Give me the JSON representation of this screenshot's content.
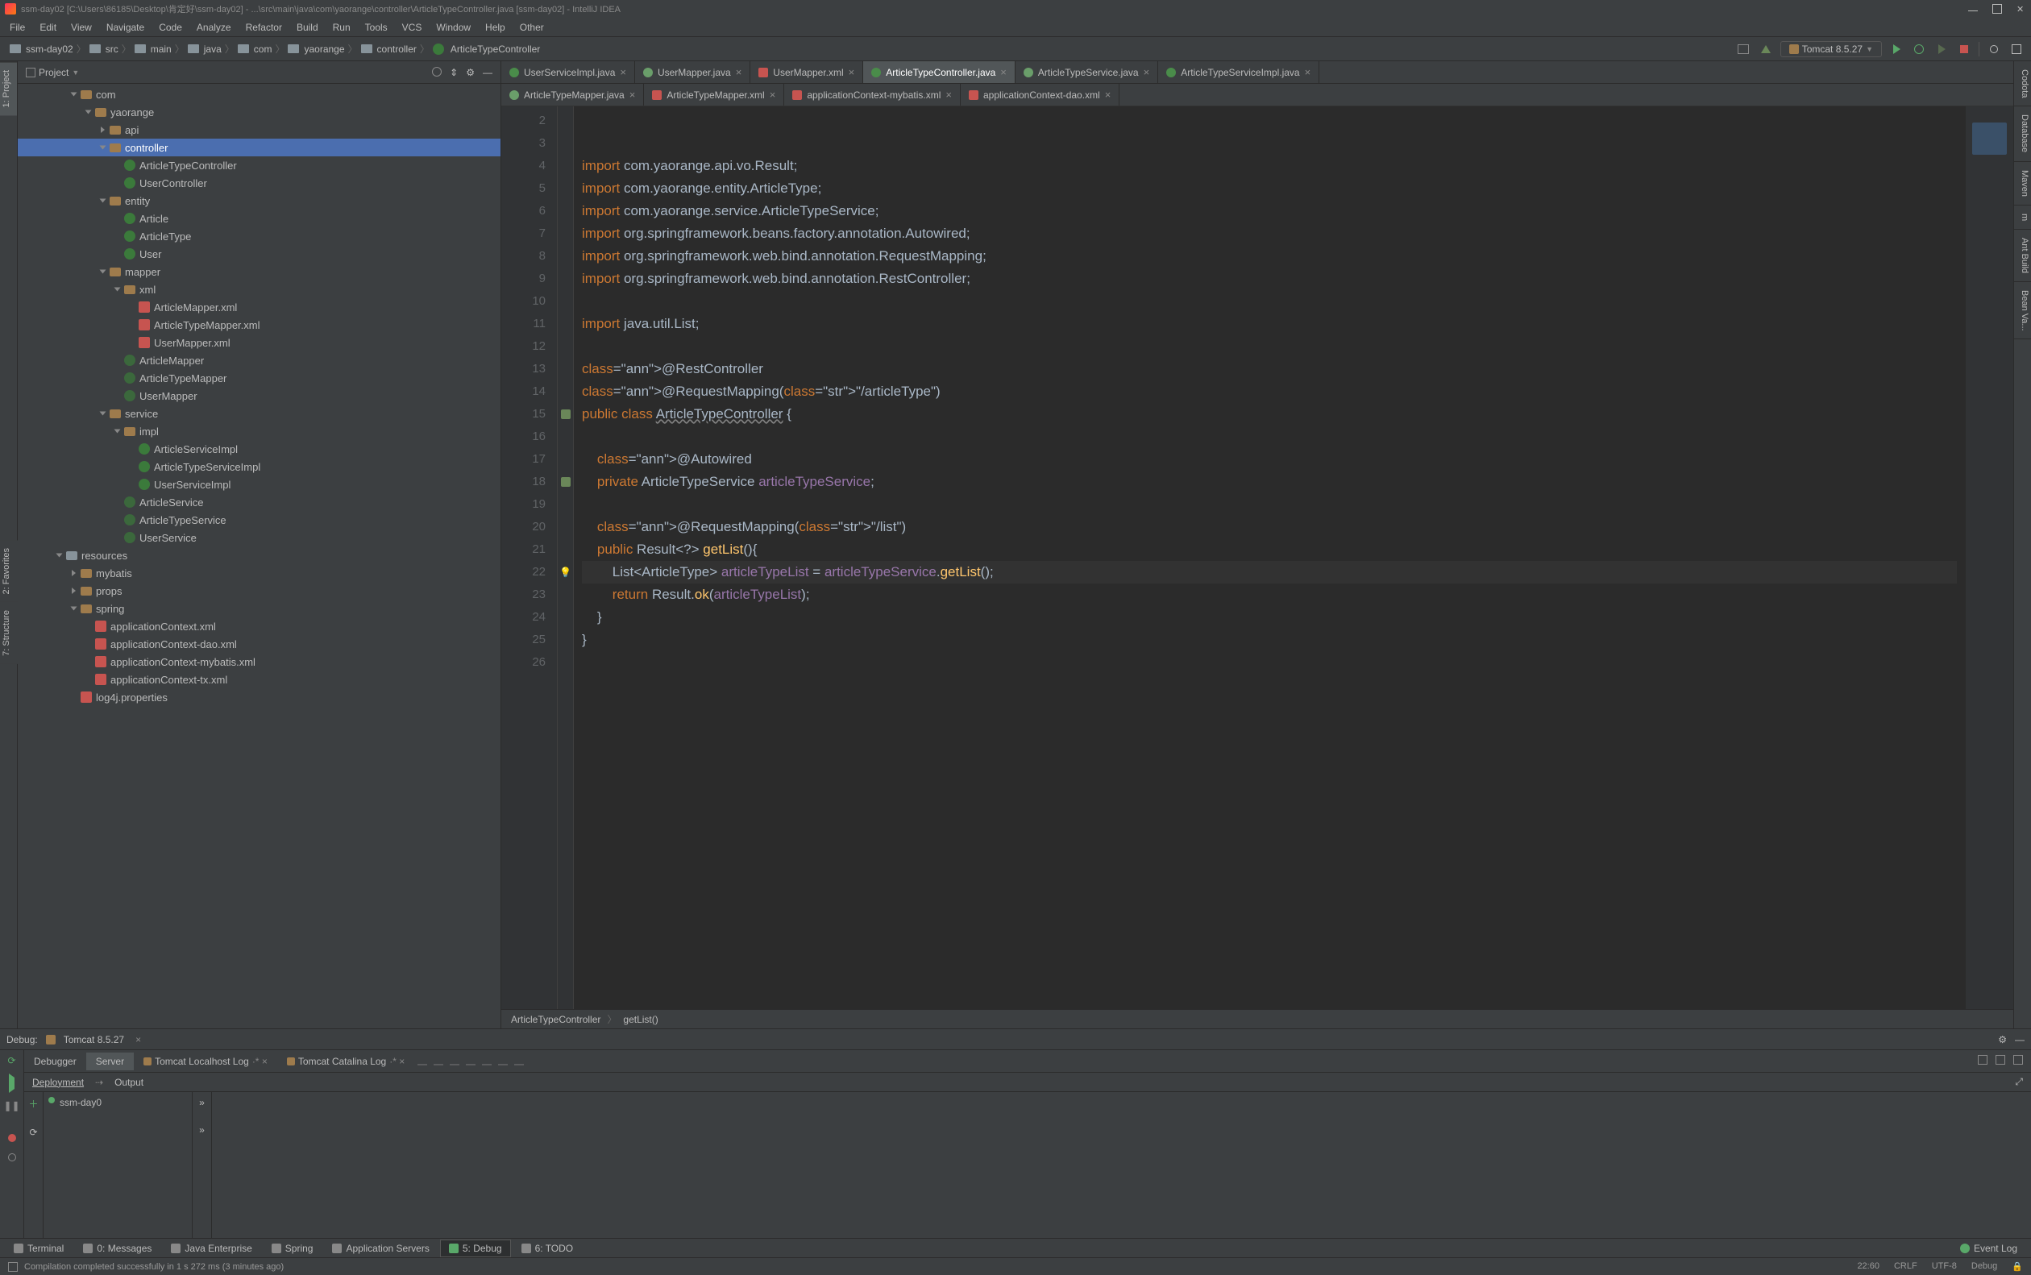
{
  "titlebar": {
    "path": "ssm-day02 [C:\\Users\\86185\\Desktop\\肯定好\\ssm-day02] - ...\\src\\main\\java\\com\\yaorange\\controller\\ArticleTypeController.java [ssm-day02] - IntelliJ IDEA"
  },
  "menu": [
    "File",
    "Edit",
    "View",
    "Navigate",
    "Code",
    "Analyze",
    "Refactor",
    "Build",
    "Run",
    "Tools",
    "VCS",
    "Window",
    "Help",
    "Other"
  ],
  "breadcrumbs": [
    "ssm-day02",
    "src",
    "main",
    "java",
    "com",
    "yaorange",
    "controller",
    "ArticleTypeController"
  ],
  "run_config": "Tomcat 8.5.27",
  "sidebar": {
    "title": "Project",
    "tree": [
      {
        "indent": 3,
        "twisty": "open",
        "icon": "pkg",
        "label": "com"
      },
      {
        "indent": 4,
        "twisty": "open",
        "icon": "pkg",
        "label": "yaorange"
      },
      {
        "indent": 5,
        "twisty": "closed",
        "icon": "pkg",
        "label": "api"
      },
      {
        "indent": 5,
        "twisty": "open",
        "icon": "pkg",
        "label": "controller",
        "selected": true
      },
      {
        "indent": 6,
        "twisty": "",
        "icon": "class",
        "label": "ArticleTypeController"
      },
      {
        "indent": 6,
        "twisty": "",
        "icon": "class",
        "label": "UserController"
      },
      {
        "indent": 5,
        "twisty": "open",
        "icon": "pkg",
        "label": "entity"
      },
      {
        "indent": 6,
        "twisty": "",
        "icon": "class",
        "label": "Article"
      },
      {
        "indent": 6,
        "twisty": "",
        "icon": "class",
        "label": "ArticleType"
      },
      {
        "indent": 6,
        "twisty": "",
        "icon": "class",
        "label": "User"
      },
      {
        "indent": 5,
        "twisty": "open",
        "icon": "pkg",
        "label": "mapper"
      },
      {
        "indent": 6,
        "twisty": "open",
        "icon": "pkg",
        "label": "xml"
      },
      {
        "indent": 7,
        "twisty": "",
        "icon": "xml",
        "label": "ArticleMapper.xml"
      },
      {
        "indent": 7,
        "twisty": "",
        "icon": "xml",
        "label": "ArticleTypeMapper.xml"
      },
      {
        "indent": 7,
        "twisty": "",
        "icon": "xml",
        "label": "UserMapper.xml"
      },
      {
        "indent": 6,
        "twisty": "",
        "icon": "iface",
        "label": "ArticleMapper"
      },
      {
        "indent": 6,
        "twisty": "",
        "icon": "iface",
        "label": "ArticleTypeMapper"
      },
      {
        "indent": 6,
        "twisty": "",
        "icon": "iface",
        "label": "UserMapper"
      },
      {
        "indent": 5,
        "twisty": "open",
        "icon": "pkg",
        "label": "service"
      },
      {
        "indent": 6,
        "twisty": "open",
        "icon": "pkg",
        "label": "impl"
      },
      {
        "indent": 7,
        "twisty": "",
        "icon": "class",
        "label": "ArticleServiceImpl"
      },
      {
        "indent": 7,
        "twisty": "",
        "icon": "class",
        "label": "ArticleTypeServiceImpl"
      },
      {
        "indent": 7,
        "twisty": "",
        "icon": "class",
        "label": "UserServiceImpl"
      },
      {
        "indent": 6,
        "twisty": "",
        "icon": "iface",
        "label": "ArticleService"
      },
      {
        "indent": 6,
        "twisty": "",
        "icon": "iface",
        "label": "ArticleTypeService"
      },
      {
        "indent": 6,
        "twisty": "",
        "icon": "iface",
        "label": "UserService"
      },
      {
        "indent": 2,
        "twisty": "open",
        "icon": "folder",
        "label": "resources"
      },
      {
        "indent": 3,
        "twisty": "closed",
        "icon": "pkg",
        "label": "mybatis"
      },
      {
        "indent": 3,
        "twisty": "closed",
        "icon": "pkg",
        "label": "props"
      },
      {
        "indent": 3,
        "twisty": "open",
        "icon": "pkg",
        "label": "spring"
      },
      {
        "indent": 4,
        "twisty": "",
        "icon": "xml",
        "label": "applicationContext.xml"
      },
      {
        "indent": 4,
        "twisty": "",
        "icon": "xml",
        "label": "applicationContext-dao.xml"
      },
      {
        "indent": 4,
        "twisty": "",
        "icon": "xml",
        "label": "applicationContext-mybatis.xml"
      },
      {
        "indent": 4,
        "twisty": "",
        "icon": "xml",
        "label": "applicationContext-tx.xml"
      },
      {
        "indent": 3,
        "twisty": "",
        "icon": "xml",
        "label": "log4j.properties"
      }
    ]
  },
  "tabs_row1": [
    {
      "label": "UserServiceImpl.java",
      "icon": "class"
    },
    {
      "label": "UserMapper.java",
      "icon": "iface"
    },
    {
      "label": "UserMapper.xml",
      "icon": "xml"
    },
    {
      "label": "ArticleTypeController.java",
      "icon": "class",
      "active": true
    },
    {
      "label": "ArticleTypeService.java",
      "icon": "iface"
    },
    {
      "label": "ArticleTypeServiceImpl.java",
      "icon": "class"
    }
  ],
  "tabs_row2": [
    {
      "label": "ArticleTypeMapper.java",
      "icon": "iface"
    },
    {
      "label": "ArticleTypeMapper.xml",
      "icon": "xml"
    },
    {
      "label": "applicationContext-mybatis.xml",
      "icon": "xml"
    },
    {
      "label": "applicationContext-dao.xml",
      "icon": "xml"
    }
  ],
  "code": {
    "line_start": 2,
    "line_end": 26,
    "lines": [
      "",
      "",
      "import com.yaorange.api.vo.Result;",
      "import com.yaorange.entity.ArticleType;",
      "import com.yaorange.service.ArticleTypeService;",
      "import org.springframework.beans.factory.annotation.Autowired;",
      "import org.springframework.web.bind.annotation.RequestMapping;",
      "import org.springframework.web.bind.annotation.RestController;",
      "",
      "import java.util.List;",
      "",
      "@RestController",
      "@RequestMapping(\"/articleType\")",
      "public class ArticleTypeController {",
      "",
      "    @Autowired",
      "    private ArticleTypeService articleTypeService;",
      "",
      "    @RequestMapping(\"/list\")",
      "    public Result<?> getList(){",
      "        List<ArticleType> articleTypeList = articleTypeService.getList();",
      "        return Result.ok(articleTypeList);",
      "    }",
      "}",
      ""
    ]
  },
  "crumb_method": {
    "class": "ArticleTypeController",
    "method": "getList()"
  },
  "debug": {
    "title": "Debug:",
    "config": "Tomcat 8.5.27",
    "tabs": [
      "Debugger",
      "Server",
      "Tomcat Localhost Log",
      "Tomcat Catalina Log"
    ],
    "active_tab": "Server",
    "subtabs": [
      "Deployment",
      "Output"
    ],
    "active_sub": "Deployment",
    "artifact": "ssm-day0"
  },
  "bottom_tabs": [
    {
      "label": "Terminal",
      "icon": "term"
    },
    {
      "label": "0: Messages",
      "icon": "msg"
    },
    {
      "label": "Java Enterprise",
      "icon": "je"
    },
    {
      "label": "Spring",
      "icon": "spring"
    },
    {
      "label": "Application Servers",
      "icon": "srv"
    },
    {
      "label": "5: Debug",
      "icon": "dbg",
      "active": true
    },
    {
      "label": "6: TODO",
      "icon": "todo"
    }
  ],
  "event_log": "Event Log",
  "status": {
    "message": "Compilation completed successfully in 1 s 272 ms (3 minutes ago)",
    "pos": "22:60",
    "lf": "CRLF",
    "enc": "UTF-8",
    "lang": "Debug"
  },
  "left_tools": [
    "1: Project"
  ],
  "right_tools": [
    "Codota",
    "Database",
    "Maven",
    "m",
    "Ant Build",
    "Bean Va..."
  ],
  "left2_tools": [
    "2: Favorites",
    "7: Structure"
  ]
}
